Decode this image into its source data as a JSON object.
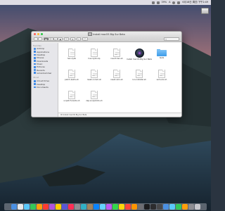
{
  "menubar": {
    "battery": "39%",
    "ime": "A",
    "datetime": "6月18日 周四 下午2:49"
  },
  "desktop": {
    "volume_label": "Install macOS Big Sur Beta"
  },
  "window": {
    "title": "Install macOS Big Sur Beta",
    "search_placeholder": "Search"
  },
  "sidebar": {
    "favorites_header": "Favorites",
    "favorites": [
      {
        "label": "AirDrop",
        "icon": "airdrop-icon"
      },
      {
        "label": "Applications",
        "icon": "applications-icon"
      },
      {
        "label": "Desktop",
        "icon": "desktop-icon"
      },
      {
        "label": "Movies",
        "icon": "movies-icon"
      },
      {
        "label": "Downloads",
        "icon": "downloads-icon"
      },
      {
        "label": "Music",
        "icon": "music-icon"
      },
      {
        "label": "Pictures",
        "icon": "pictures-icon"
      },
      {
        "label": "Recents",
        "icon": "recents-icon"
      },
      {
        "label": "lemonhammer",
        "icon": "home-icon"
      }
    ],
    "icloud_header": "iCloud",
    "icloud": [
      {
        "label": "iCloud Drive",
        "icon": "icloud-icon"
      },
      {
        "label": "Desktop",
        "icon": "desktop-icon"
      },
      {
        "label": "Documents",
        "icon": "documents-icon"
      }
    ]
  },
  "files": [
    {
      "label": "hax.dylib",
      "kind": "doc"
    },
    {
      "label": "hax.dylib.zip",
      "kind": "doc"
    },
    {
      "label": "insert-hax.sh",
      "kind": "sh"
    },
    {
      "label": "Install macOS Big Sur Beta",
      "kind": "app"
    },
    {
      "label": "tests",
      "kind": "folder"
    },
    {
      "label": "patch-kexts.sh",
      "kind": "sh"
    },
    {
      "label": "reset-nvram.sh",
      "kind": "sh"
    },
    {
      "label": "reset-vars.sh",
      "kind": "sh"
    },
    {
      "label": "run-installer.sh",
      "kind": "sh"
    },
    {
      "label": "set-vars.sh",
      "kind": "sh"
    },
    {
      "label": "unpatch-kexts.sh",
      "kind": "sh"
    },
    {
      "label": "zap-snapshots.sh",
      "kind": "sh"
    }
  ],
  "pathbar": {
    "text": "Install macOS Big Sur Beta"
  },
  "colors": {
    "accent": "#3b88e6",
    "close": "#fd5f57",
    "minimize": "#febb2d",
    "zoom": "#28c840"
  }
}
